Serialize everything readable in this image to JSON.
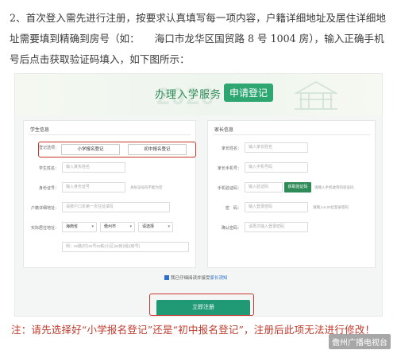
{
  "intro": {
    "line1": "2、首次登入需先进行注册，按要求认真填写每一项内容，户籍详细地址及居住详细地",
    "line2": "址需要填到精确到房号（如：　　海口市龙华区国贸路 8 号 1004 房），输入正确手机",
    "line3": "号后点击获取验证码填入，如下图所示："
  },
  "banner": {
    "title": "办理入学服务",
    "badge": "申请登记",
    "ghost": "2020"
  },
  "student": {
    "title": "学生信息",
    "register_label": "登记选项：",
    "primary_btn": "小学报名登记",
    "junior_btn": "初中报名登记",
    "name_label": "学生姓名：",
    "name_placeholder": "输入真实姓名",
    "id_label": "身份证号：",
    "id_placeholder": "输入身份证号",
    "id_hint": "身份证号码不能为空",
    "hukou_label": "户籍详细地址：",
    "hukou_placeholder": "请按户口本第一页住址填写",
    "live_label": "实际居住地址：",
    "province": "海南省",
    "city": "儋州市",
    "district": "请选择",
    "live_placeholder": "例：xx路(村)xx号xx栋(小区)xx房(组)(房号)"
  },
  "parent": {
    "title": "家长信息",
    "name_label": "家长姓名：",
    "name_placeholder": "输入家长姓名",
    "phone_label": "家长手机号：",
    "phone_placeholder": "输入手机号码",
    "code_label": "手机验证码：",
    "code_placeholder": "输入验证码",
    "code_btn": "获取验证码",
    "code_hint": "请输入手机收到的验证码",
    "pwd_label": "密　码：",
    "pwd_placeholder": "输入登录密码",
    "pwd_hint": "请输入6-20位登录密码",
    "confirm_label": "确认密码：",
    "confirm_placeholder": "请再次输入登录密码"
  },
  "agree": {
    "text": "我已仔细阅读并接受",
    "link": "家长须知"
  },
  "submit_label": "立即注册",
  "note": "注：请先选择好“小学报名登记”还是“初中报名登记”，注册后此项无法进行修改！",
  "watermark": "儋州广播电视台"
}
